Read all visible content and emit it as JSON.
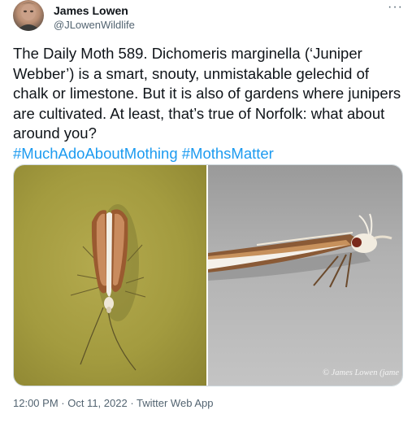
{
  "author": {
    "name": "James Lowen",
    "handle": "@JLowenWildlife",
    "more_icon": "ellipsis-icon"
  },
  "tweet": {
    "text": "The Daily Moth 589. Dichomeris marginella (‘Juniper Webber’) is a smart, snouty, unmistakable gelechid of chalk or limestone. But it is also of gardens where junipers are cultivated. At least, that’s true of Norfolk: what about around you?",
    "hashtags": [
      "#MuchAdoAboutMothing",
      "#MothsMatter"
    ]
  },
  "media": {
    "watermark": "© James Lowen (jame"
  },
  "meta": {
    "time": "12:00 PM",
    "date": "Oct 11, 2022",
    "separator": " · ",
    "source": "Twitter Web App"
  },
  "colors": {
    "link": "#1d9bf0",
    "secondary_text": "#536471",
    "primary_text": "#0f1419"
  }
}
